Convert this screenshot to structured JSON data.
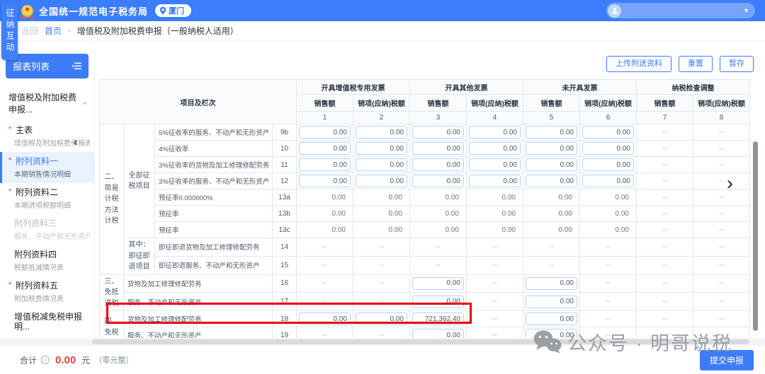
{
  "colors": {
    "accent": "#3D7CF8",
    "topbar": "#3C7DFB",
    "highlight_red": "#E60012",
    "total_red": "#F53F3F"
  },
  "header": {
    "side_tab": "征纳互动",
    "app_title": "全国统一规范电子税务局",
    "location_badge": "厦门",
    "user": {
      "avatar_icon": "person-icon",
      "caret_icon": "chevron-down-icon"
    }
  },
  "breadcrumb": {
    "back": "返回",
    "home": "首页",
    "separator": "›",
    "current": "增值税及附加税费申报（一般纳税人适用）"
  },
  "sidebar": {
    "title": "报表列表",
    "collapse_icon": "collapse-list-icon",
    "group_label": "增值税及附加税费申报...",
    "group_caret": "chevron-up-icon",
    "items": [
      {
        "title": "主表",
        "subtitle": "增值税及附加税费申报表",
        "required": true,
        "state": "normal"
      },
      {
        "title": "附列资料一",
        "subtitle": "本期销售情况明细",
        "required": true,
        "state": "active"
      },
      {
        "title": "附列资料二",
        "subtitle": "本期进项税额明细",
        "required": true,
        "state": "normal"
      },
      {
        "title": "附列资料三",
        "subtitle": "服务、不动产和无形资产扣..",
        "required": false,
        "state": "disabled"
      },
      {
        "title": "附列资料四",
        "subtitle": "税额抵减情况表",
        "required": false,
        "state": "normal"
      },
      {
        "title": "附列资料五",
        "subtitle": "附加税费情况表",
        "required": true,
        "state": "normal"
      },
      {
        "title": "增值税减免税申报明...",
        "subtitle": "",
        "required": false,
        "state": "normal"
      }
    ]
  },
  "toolbar": {
    "buttons": [
      "上传附送资料",
      "重置",
      "暂存"
    ]
  },
  "table": {
    "corner_label": "项目及栏次",
    "col_groups": [
      "开具增值税专用发票",
      "开具其他发票",
      "未开具发票",
      "纳税检查调整"
    ],
    "sub_headers": [
      "销售额",
      "销项(应纳)税额"
    ],
    "col_numbers": [
      "1",
      "2",
      "3",
      "4",
      "5",
      "6",
      "7",
      "8"
    ],
    "rows": [
      {
        "group": "二、简易计税方法计税",
        "group_span": 9,
        "subgroup": "全部征税项目",
        "subgroup_span": 7,
        "name": "5%征收率的服务、不动产和无形资产",
        "num": "9b",
        "cells": [
          {
            "t": "input",
            "v": "0.00"
          },
          {
            "t": "input",
            "v": "0.00"
          },
          {
            "t": "input",
            "v": "0.00"
          },
          {
            "t": "input",
            "v": "0.00"
          },
          {
            "t": "input",
            "v": "0.00"
          },
          {
            "t": "input",
            "v": "0.00"
          },
          {
            "t": "dash"
          },
          {
            "t": "dash"
          }
        ]
      },
      {
        "name": "4%征收率",
        "num": "10",
        "cells": [
          {
            "t": "input",
            "v": "0.00"
          },
          {
            "t": "input",
            "v": "0.00"
          },
          {
            "t": "input",
            "v": "0.00"
          },
          {
            "t": "input",
            "v": "0.00"
          },
          {
            "t": "input",
            "v": "0.00"
          },
          {
            "t": "input",
            "v": "0.00"
          },
          {
            "t": "dash"
          },
          {
            "t": "dash"
          }
        ]
      },
      {
        "name": "3%征收率的货物及加工修理修配劳务",
        "num": "11",
        "cells": [
          {
            "t": "input",
            "v": "0.00"
          },
          {
            "t": "input",
            "v": "0.00"
          },
          {
            "t": "input",
            "v": "0.00"
          },
          {
            "t": "input",
            "v": "0.00"
          },
          {
            "t": "input",
            "v": "0.00"
          },
          {
            "t": "input",
            "v": "0.00"
          },
          {
            "t": "dash"
          },
          {
            "t": "dash"
          }
        ]
      },
      {
        "name": "3%征收率的服务、不动产和无形资产",
        "num": "12",
        "cells": [
          {
            "t": "input",
            "v": "0.00"
          },
          {
            "t": "input",
            "v": "0.00"
          },
          {
            "t": "input",
            "v": "0.00"
          },
          {
            "t": "input",
            "v": "0.00"
          },
          {
            "t": "input",
            "v": "0.00"
          },
          {
            "t": "input",
            "v": "0.00"
          },
          {
            "t": "dash"
          },
          {
            "t": "dash"
          }
        ]
      },
      {
        "name": "预征率0.000000%",
        "num": "13a",
        "cells": [
          {
            "t": "text",
            "v": "0.00"
          },
          {
            "t": "text",
            "v": "0.00"
          },
          {
            "t": "text",
            "v": "0.00"
          },
          {
            "t": "text",
            "v": "0.00"
          },
          {
            "t": "text",
            "v": "0.00"
          },
          {
            "t": "text",
            "v": "0.00"
          },
          {
            "t": "dash"
          },
          {
            "t": "dash"
          }
        ]
      },
      {
        "name": "预征率",
        "num": "13b",
        "cells": [
          {
            "t": "text",
            "v": "0.00"
          },
          {
            "t": "text",
            "v": "0.00"
          },
          {
            "t": "text",
            "v": "0.00"
          },
          {
            "t": "text",
            "v": "0.00"
          },
          {
            "t": "text",
            "v": "0.00"
          },
          {
            "t": "text",
            "v": "0.00"
          },
          {
            "t": "dash"
          },
          {
            "t": "dash"
          }
        ]
      },
      {
        "name": "预征率",
        "num": "13c",
        "cells": [
          {
            "t": "text",
            "v": "0.00"
          },
          {
            "t": "text",
            "v": "0.00"
          },
          {
            "t": "text",
            "v": "0.00"
          },
          {
            "t": "text",
            "v": "0.00"
          },
          {
            "t": "text",
            "v": "0.00"
          },
          {
            "t": "text",
            "v": "0.00"
          },
          {
            "t": "dash"
          },
          {
            "t": "dash"
          }
        ]
      },
      {
        "subgroup": "其中：即征即退项目",
        "subgroup_span": 2,
        "name": "即征即退货物及加工修理修配劳务",
        "num": "14",
        "cells": [
          {
            "t": "dash"
          },
          {
            "t": "dash"
          },
          {
            "t": "dash"
          },
          {
            "t": "dash"
          },
          {
            "t": "dash"
          },
          {
            "t": "dash"
          },
          {
            "t": "dash"
          },
          {
            "t": "dash"
          }
        ]
      },
      {
        "name": "即征即退服务、不动产和无形资产",
        "num": "15",
        "cells": [
          {
            "t": "dash"
          },
          {
            "t": "dash"
          },
          {
            "t": "dash"
          },
          {
            "t": "dash"
          },
          {
            "t": "dash"
          },
          {
            "t": "dash"
          },
          {
            "t": "dash"
          },
          {
            "t": "dash"
          }
        ]
      },
      {
        "group": "三、免抵退税",
        "group_span": 2,
        "name_span": 2,
        "name": "货物及加工修理修配劳务",
        "num": "16",
        "cells": [
          {
            "t": "dash"
          },
          {
            "t": "dash"
          },
          {
            "t": "input",
            "v": "0.00"
          },
          {
            "t": "dash"
          },
          {
            "t": "input",
            "v": "0.00"
          },
          {
            "t": "dash"
          },
          {
            "t": "dash"
          },
          {
            "t": "dash"
          }
        ]
      },
      {
        "name_span": 2,
        "name": "服务、不动产和无形资产",
        "num": "17",
        "cells": [
          {
            "t": "dash"
          },
          {
            "t": "dash"
          },
          {
            "t": "input",
            "v": "0.00"
          },
          {
            "t": "dash"
          },
          {
            "t": "input",
            "v": "0.00"
          },
          {
            "t": "dash"
          },
          {
            "t": "dash"
          },
          {
            "t": "dash"
          }
        ]
      },
      {
        "group": "四、免税",
        "group_span": 2,
        "name_span": 2,
        "name": "货物及加工修理修配劳务",
        "num": "18",
        "highlight": true,
        "cells": [
          {
            "t": "input",
            "v": "0.00"
          },
          {
            "t": "input",
            "v": "0.00"
          },
          {
            "t": "input",
            "v": "721,362.40"
          },
          {
            "t": "dash"
          },
          {
            "t": "input",
            "v": "0.00"
          },
          {
            "t": "dash"
          },
          {
            "t": "dash"
          },
          {
            "t": "dash"
          }
        ]
      },
      {
        "name_span": 2,
        "name": "服务、不动产和无形资产",
        "num": "19",
        "cells": [
          {
            "t": "dash"
          },
          {
            "t": "dash"
          },
          {
            "t": "input",
            "v": "0.00"
          },
          {
            "t": "dash"
          },
          {
            "t": "input",
            "v": "0.00"
          },
          {
            "t": "dash"
          },
          {
            "t": "dash"
          },
          {
            "t": "dash"
          }
        ]
      }
    ]
  },
  "footer": {
    "total_label": "合计",
    "total_value": "0.00",
    "total_unit": "元",
    "total_words": "（零元整）",
    "submit_label": "提交申报"
  },
  "watermark": {
    "text": "公众号 · 明哥说税",
    "icon": "wechat-icon"
  }
}
